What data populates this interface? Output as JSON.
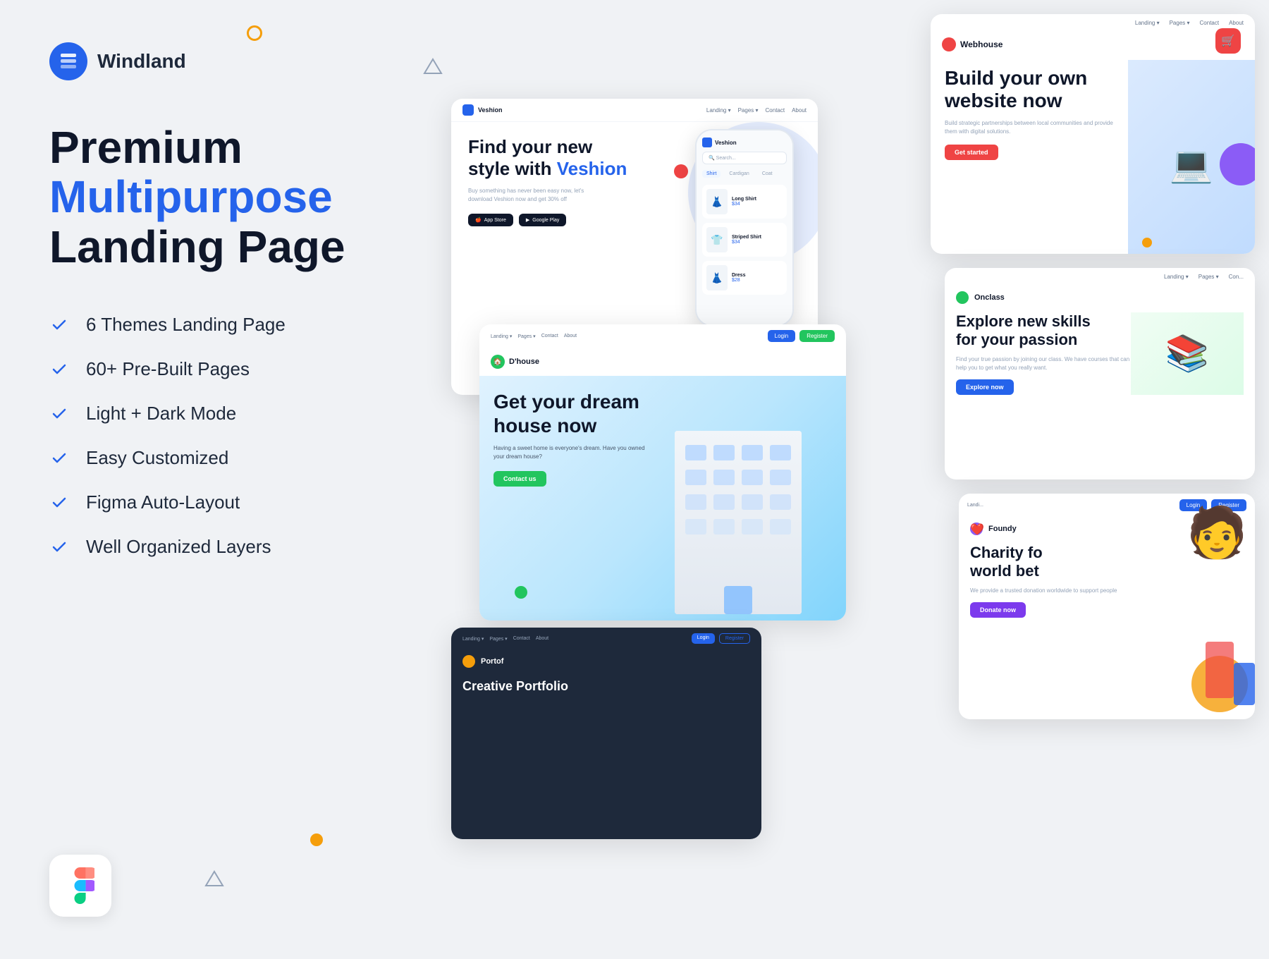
{
  "brand": {
    "name": "Windland",
    "logo_alt": "Windland layers icon"
  },
  "headline": {
    "line1_plain": "Premium ",
    "line1_accent": "Multipurpose",
    "line2": "Landing Page"
  },
  "features": [
    {
      "label": "6 Themes Landing Page"
    },
    {
      "label": "60+ Pre-Built Pages"
    },
    {
      "label": "Light + Dark Mode"
    },
    {
      "label": "Easy Customized"
    },
    {
      "label": "Figma Auto-Layout"
    },
    {
      "label": "Well Organized Layers"
    }
  ],
  "previews": {
    "veshion": {
      "name": "Veshion",
      "headline_line1": "Find your new",
      "headline_line2": "style with",
      "headline_accent": "Veshion",
      "sub": "Buy something has never been easy now, let's download Veshion now and get 30% off",
      "appstore": "App Store",
      "googleplay": "Google Play",
      "nav_items": [
        "Landing",
        "Pages",
        "Contact",
        "About"
      ],
      "products": [
        {
          "name": "Striped Shirt",
          "price": "$34"
        },
        {
          "name": "Long Shirt",
          "price": "$34"
        }
      ]
    },
    "webhouse": {
      "name": "Webhouse",
      "headline": "Build your own website now",
      "sub": "Build strategic partnerships between local communities and provide them with digital solutions.",
      "cta": "Get started",
      "nav_items": [
        "Landing",
        "Pages",
        "Contact",
        "About"
      ]
    },
    "onclass": {
      "name": "Onclass",
      "headline_line1": "Explore new skills",
      "headline_line2": "for your passion",
      "sub": "Find your true passion by joining our class. We have courses that can help you to get what you really want.",
      "cta": "Explore now",
      "nav_items": [
        "Landing",
        "Pages",
        "Con"
      ]
    },
    "dhouse": {
      "name": "D'house",
      "headline_line1": "Get your dream",
      "headline_line2": "house now",
      "sub": "Having a sweet home is everyone's dream. Have you owned your dream house?",
      "cta": "Contact us",
      "nav_items": [
        "Landing",
        "Pages",
        "Contact",
        "About"
      ],
      "auth": {
        "login": "Login",
        "register": "Register"
      }
    },
    "foundy": {
      "name": "Foundy",
      "headline_line1": "Charity fo",
      "headline_line2": "world bet",
      "sub": "We provide a trusted donation worldwide to support people",
      "cta": "Donate now",
      "nav_items": [
        "Landi"
      ]
    },
    "portof": {
      "name": "Portof",
      "nav_items": [
        "Landing",
        "Pages",
        "Contact",
        "About"
      ],
      "auth": {
        "login": "Login",
        "register": "Register"
      }
    }
  },
  "deco": {
    "circles": "decorative geometric shapes",
    "triangles": "decorative triangles"
  }
}
